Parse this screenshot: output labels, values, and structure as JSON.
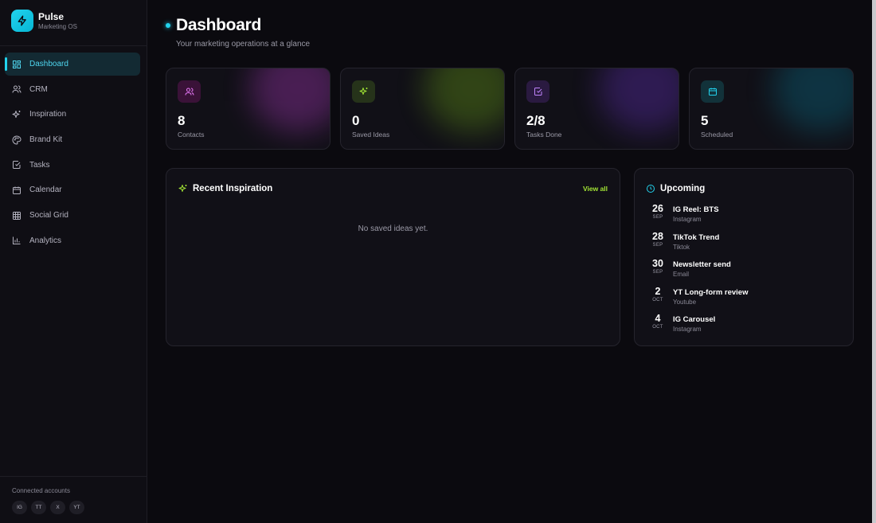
{
  "brand": {
    "name": "Pulse",
    "subtitle": "Marketing OS"
  },
  "nav": [
    {
      "label": "Dashboard",
      "icon": "dashboard-icon",
      "active": true
    },
    {
      "label": "CRM",
      "icon": "users-icon"
    },
    {
      "label": "Inspiration",
      "icon": "sparkles-icon"
    },
    {
      "label": "Brand Kit",
      "icon": "palette-icon"
    },
    {
      "label": "Tasks",
      "icon": "checkbox-icon"
    },
    {
      "label": "Calendar",
      "icon": "calendar-icon"
    },
    {
      "label": "Social Grid",
      "icon": "grid-icon"
    },
    {
      "label": "Analytics",
      "icon": "bar-chart-icon"
    }
  ],
  "connected": {
    "label": "Connected accounts",
    "accounts": [
      "IG",
      "TT",
      "X",
      "YT"
    ]
  },
  "header": {
    "title": "Dashboard",
    "subtitle": "Your marketing operations at a glance"
  },
  "stats": [
    {
      "value": "8",
      "label": "Contacts",
      "icon": "users-icon",
      "color": "#d946ef"
    },
    {
      "value": "0",
      "label": "Saved Ideas",
      "icon": "sparkles-icon",
      "color": "#a3e635"
    },
    {
      "value": "2/8",
      "label": "Tasks Done",
      "icon": "checkbox-icon",
      "color": "#a855f7"
    },
    {
      "value": "5",
      "label": "Scheduled",
      "icon": "calendar-icon",
      "color": "#22d3ee"
    }
  ],
  "inspiration": {
    "title": "Recent Inspiration",
    "view_all": "View all",
    "empty": "No saved ideas yet."
  },
  "upcoming": {
    "title": "Upcoming",
    "items": [
      {
        "day": "26",
        "month": "SEP",
        "title": "IG Reel: BTS",
        "platform": "Instagram"
      },
      {
        "day": "28",
        "month": "SEP",
        "title": "TikTok Trend",
        "platform": "Tiktok"
      },
      {
        "day": "30",
        "month": "SEP",
        "title": "Newsletter send",
        "platform": "Email"
      },
      {
        "day": "2",
        "month": "OCT",
        "title": "YT Long-form review",
        "platform": "Youtube"
      },
      {
        "day": "4",
        "month": "OCT",
        "title": "IG Carousel",
        "platform": "Instagram"
      }
    ]
  }
}
